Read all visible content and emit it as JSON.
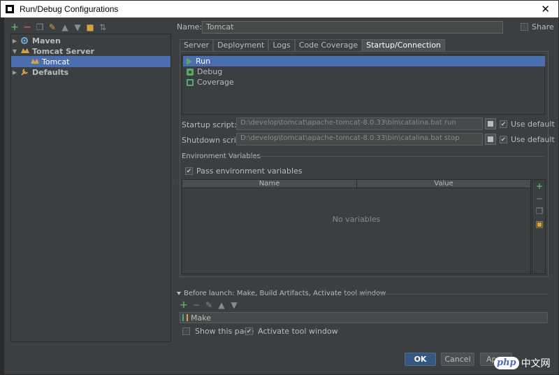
{
  "window": {
    "title": "Run/Debug Configurations",
    "close_glyph": "✕"
  },
  "left_toolbar": {
    "icons": [
      "add-icon",
      "remove-icon",
      "copy-icon",
      "edit-defaults-icon",
      "move-up-icon",
      "move-down-icon",
      "folder-icon",
      "sort-icon"
    ]
  },
  "tree": {
    "items": [
      {
        "label": "Maven",
        "expanded": false
      },
      {
        "label": "Tomcat Server",
        "expanded": true
      },
      {
        "label": "Tomcat",
        "selected": true
      },
      {
        "label": "Defaults",
        "expanded": false
      }
    ]
  },
  "form": {
    "name_label": "Name:",
    "name_value": "Tomcat",
    "share_label": "Share",
    "share_checked": false
  },
  "tabs": [
    {
      "label": "Server"
    },
    {
      "label": "Deployment"
    },
    {
      "label": "Logs"
    },
    {
      "label": "Code Coverage"
    },
    {
      "label": "Startup/Connection",
      "active": true
    }
  ],
  "executors": [
    {
      "label": "Run",
      "selected": true
    },
    {
      "label": "Debug"
    },
    {
      "label": "Coverage"
    }
  ],
  "startup": {
    "label": "Startup script:",
    "value": "D:\\develop\\tomcat\\apache-tomcat-8.0.33\\bin\\catalina.bat run",
    "use_default": "Use default"
  },
  "shutdown": {
    "label": "Shutdown script:",
    "value": "D:\\develop\\tomcat\\apache-tomcat-8.0.33\\bin\\catalina.bat stop",
    "use_default": "Use default"
  },
  "env": {
    "title": "Environment Variables",
    "pass_label": "Pass environment variables",
    "col_name": "Name",
    "col_value": "Value",
    "empty_text": "No variables"
  },
  "before_launch": {
    "title": "Before launch: Make, Build Artifacts, Activate tool window",
    "item": "Make",
    "show_page": "Show this page",
    "activate_window": "Activate tool window"
  },
  "buttons": {
    "ok": "OK",
    "cancel": "Cancel",
    "apply": "Ap"
  },
  "watermark": {
    "logo": "php",
    "text": "中文网"
  },
  "colors": {
    "selection": "#4b6eaf",
    "background": "#3c3f41",
    "accent_green": "#59a869",
    "ok_button": "#365880"
  }
}
